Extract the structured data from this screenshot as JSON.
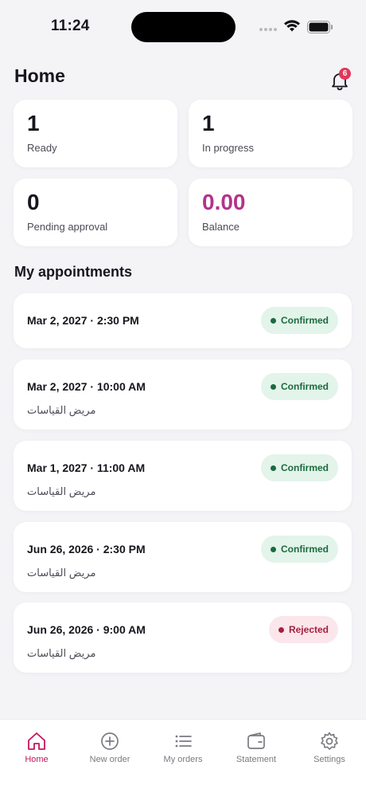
{
  "status_bar": {
    "time": "11:24"
  },
  "header": {
    "title": "Home",
    "notification_count": "6"
  },
  "stats": {
    "ready": {
      "value": "1",
      "label": "Ready"
    },
    "in_progress": {
      "value": "1",
      "label": "In progress"
    },
    "pending_approval": {
      "value": "0",
      "label": "Pending approval"
    },
    "balance": {
      "value": "0.00",
      "label": "Balance"
    }
  },
  "appointments_title": "My appointments",
  "appointments": [
    {
      "date": "Mar 2, 2027 · 2:30 PM",
      "subtitle": "",
      "status": "Confirmed"
    },
    {
      "date": "Mar 2, 2027 · 10:00 AM",
      "subtitle": "مريض القياسات",
      "status": "Confirmed"
    },
    {
      "date": "Mar 1, 2027 · 11:00 AM",
      "subtitle": "مريض القياسات",
      "status": "Confirmed"
    },
    {
      "date": "Jun 26, 2026 · 2:30 PM",
      "subtitle": "مريض القياسات",
      "status": "Confirmed"
    },
    {
      "date": "Jun 26, 2026 · 9:00 AM",
      "subtitle": "مريض القياسات",
      "status": "Rejected"
    }
  ],
  "tabs": [
    {
      "label": "Home",
      "icon": "home-icon",
      "active": true
    },
    {
      "label": "New order",
      "icon": "plus-circle-icon",
      "active": false
    },
    {
      "label": "My orders",
      "icon": "list-icon",
      "active": false
    },
    {
      "label": "Statement",
      "icon": "wallet-icon",
      "active": false
    },
    {
      "label": "Settings",
      "icon": "gear-icon",
      "active": false
    }
  ],
  "colors": {
    "accent": "#c2185b",
    "balance": "#b2348c",
    "confirmed_bg": "#e3f4ea",
    "confirmed_text": "#1c6b3e",
    "rejected_bg": "#fbe6ec",
    "rejected_text": "#a3213e"
  }
}
